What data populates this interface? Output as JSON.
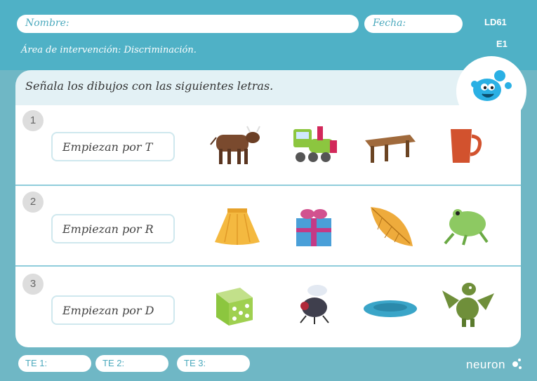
{
  "header": {
    "name_label": "Nombre:",
    "date_label": "Fecha:",
    "code": "LD61",
    "exercise": "E1",
    "area": "Área de intervención: Discriminación."
  },
  "instruction": "Señala los dibujos con las siguientes letras.",
  "rows": [
    {
      "number": "1",
      "label": "Empiezan por T",
      "pictures": [
        "cow-picture",
        "train-picture",
        "table-picture",
        "mug-picture"
      ]
    },
    {
      "number": "2",
      "label": "Empiezan por R",
      "pictures": [
        "skirt-picture",
        "gift-picture",
        "leaf-picture",
        "frog-picture"
      ]
    },
    {
      "number": "3",
      "label": "Empiezan por D",
      "pictures": [
        "dice-picture",
        "fly-picture",
        "plate-picture",
        "dragon-picture"
      ]
    }
  ],
  "footer": {
    "te1": "TE 1:",
    "te2": "TE 2:",
    "te3": "TE 3:",
    "brand": "neuron"
  },
  "colors": {
    "header_blue": "#4fb1c6",
    "background_blue": "#6fb7c5",
    "text_blue": "#4ba9bd"
  }
}
